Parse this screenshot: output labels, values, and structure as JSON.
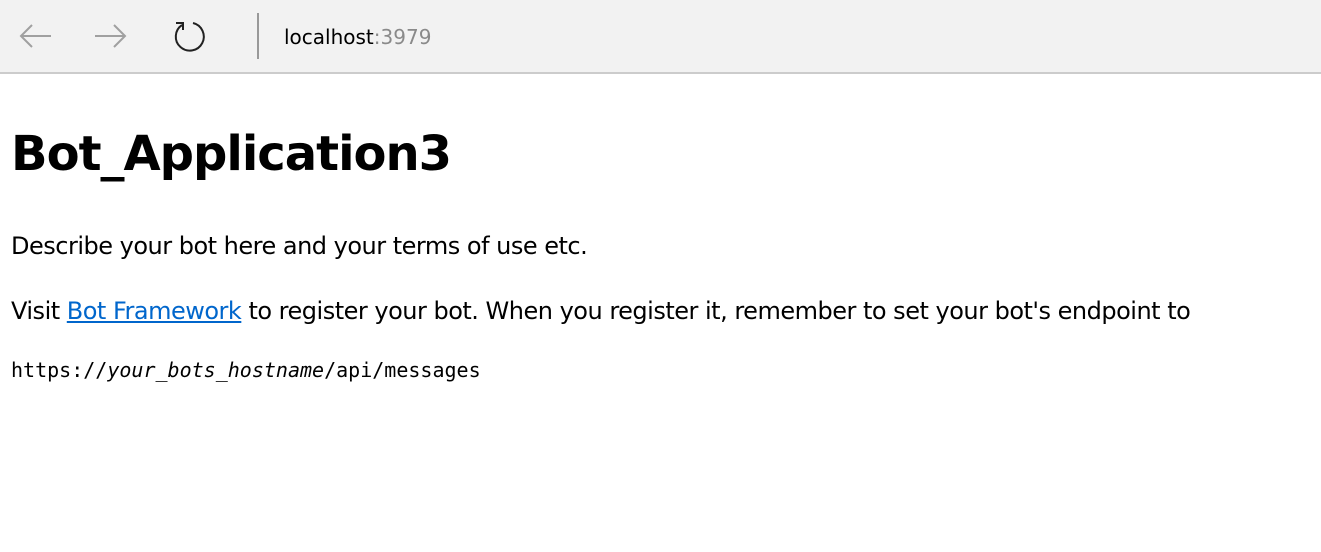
{
  "browser": {
    "address": {
      "host": "localhost",
      "port": ":3979"
    },
    "icons": {
      "back": "arrow-left-icon",
      "forward": "arrow-right-icon",
      "refresh": "refresh-icon"
    }
  },
  "page": {
    "title": "Bot_Application3",
    "description": "Describe your bot here and your terms of use etc.",
    "visit_prefix": "Visit ",
    "link_text": "Bot Framework",
    "visit_suffix": " to register your bot. When you register it, remember to set your bot's endpoint to",
    "endpoint": {
      "scheme": "https://",
      "host_placeholder": "your_bots_hostname",
      "path": "/api/messages"
    }
  },
  "colors": {
    "toolbar_bg": "#f2f2f2",
    "link": "#0066cc",
    "port_text": "#8a8a8a"
  }
}
